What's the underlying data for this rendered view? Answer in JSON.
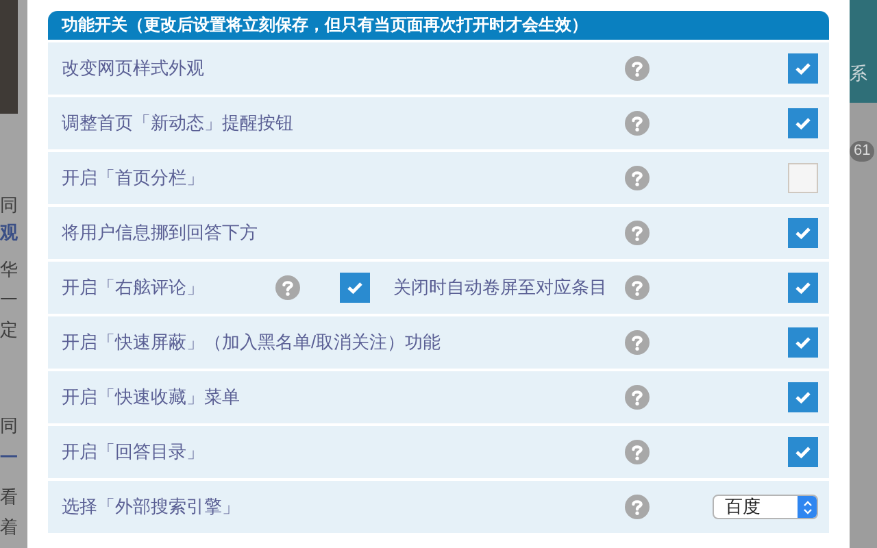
{
  "background": {
    "left_fragments": [
      {
        "text": "同",
        "emphasis": false
      },
      {
        "text": "观",
        "emphasis": true
      },
      {
        "text": "华",
        "emphasis": false
      },
      {
        "text": "一",
        "emphasis": false
      },
      {
        "text": "定",
        "emphasis": false
      },
      {
        "text": "同",
        "emphasis": false
      },
      {
        "text": "一",
        "emphasis": true
      },
      {
        "text": "看",
        "emphasis": false
      },
      {
        "text": "着",
        "emphasis": false
      }
    ],
    "right_banner_text": "系",
    "right_badge": "61"
  },
  "panel": {
    "title": "功能开关（更改后设置将立刻保存，但只有当页面再次打开时才会生效）"
  },
  "settings": [
    {
      "kind": "checkbox",
      "label": "改变网页样式外观",
      "checked": true
    },
    {
      "kind": "checkbox",
      "label": "调整首页「新动态」提醒按钮",
      "checked": true
    },
    {
      "kind": "checkbox",
      "label": "开启「首页分栏」",
      "checked": false
    },
    {
      "kind": "checkbox",
      "label": "将用户信息挪到回答下方",
      "checked": true
    },
    {
      "kind": "checkbox-with-option",
      "label": "开启「右舷评论」",
      "checked": true,
      "option": {
        "label": "关闭时自动卷屏至对应条目",
        "checked": true
      }
    },
    {
      "kind": "checkbox",
      "label": "开启「快速屏蔽」（加入黑名单/取消关注）功能",
      "checked": true
    },
    {
      "kind": "checkbox",
      "label": "开启「快速收藏」菜单",
      "checked": true
    },
    {
      "kind": "checkbox",
      "label": "开启「回答目录」",
      "checked": true
    },
    {
      "kind": "select",
      "label": "选择「外部搜索引擎」",
      "value": "百度"
    }
  ]
}
